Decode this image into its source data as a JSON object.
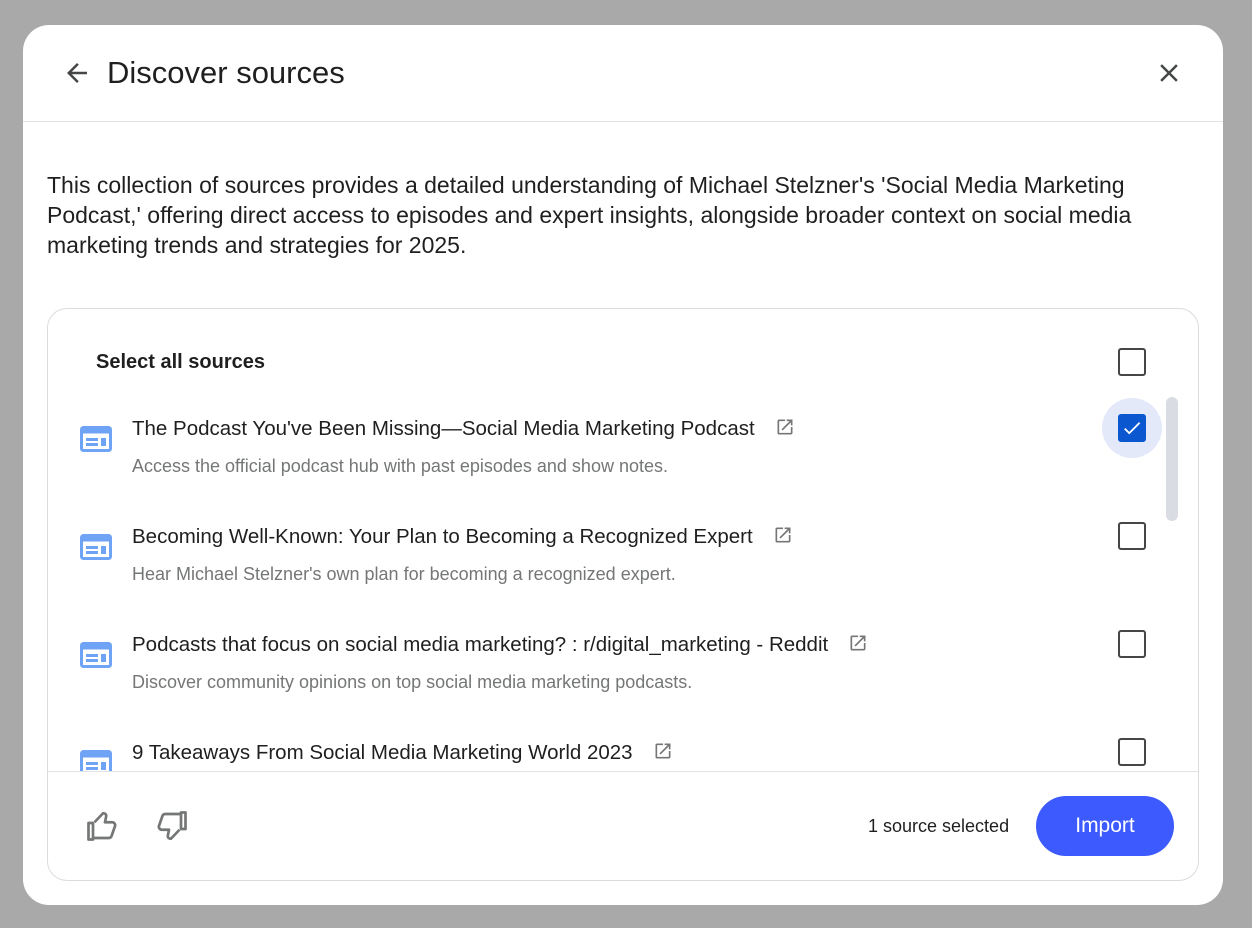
{
  "header": {
    "title": "Discover sources"
  },
  "description": "This collection of sources provides a detailed understanding of Michael Stelzner's 'Social Media Marketing Podcast,' offering direct access to episodes and expert insights, alongside broader context on social media marketing trends and strategies for 2025.",
  "select_all": {
    "label": "Select all sources",
    "checked": false
  },
  "sources": [
    {
      "title": "The Podcast You've Been Missing—Social Media Marketing Podcast",
      "description": "Access the official podcast hub with past episodes and show notes.",
      "checked": true,
      "icon": "web-page-icon"
    },
    {
      "title": "Becoming Well-Known: Your Plan to Becoming a Recognized Expert",
      "description": "Hear Michael Stelzner's own plan for becoming a recognized expert.",
      "checked": false,
      "icon": "web-page-icon"
    },
    {
      "title": "Podcasts that focus on social media marketing? : r/digital_marketing - Reddit",
      "description": "Discover community opinions on top social media marketing podcasts.",
      "checked": false,
      "icon": "web-page-icon"
    },
    {
      "title": "9 Takeaways From Social Media Marketing World 2023",
      "description": "",
      "checked": false,
      "icon": "web-page-icon"
    }
  ],
  "footer": {
    "selected_count": "1 source selected",
    "import_label": "Import"
  },
  "colors": {
    "accent": "#3d5afe",
    "checkbox_checked": "#0b57d0",
    "source_icon": "#6fa3f5"
  }
}
